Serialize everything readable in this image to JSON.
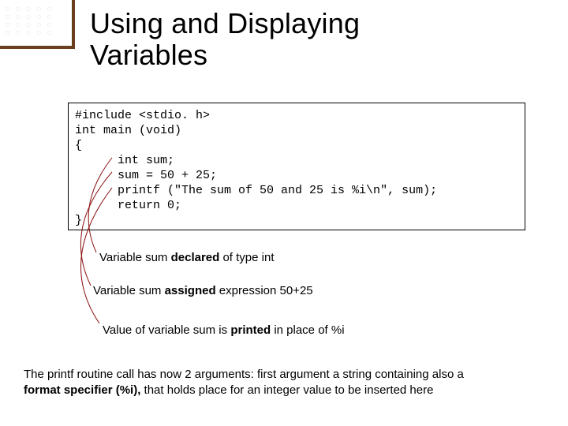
{
  "title_line1": "Using and Displaying",
  "title_line2": "Variables",
  "code": {
    "l1": "#include <stdio. h>",
    "l2": "int main (void)",
    "l3": "{",
    "l4": "      int sum;",
    "l5": "      sum = 50 + 25;",
    "l6": "      printf (\"The sum of 50 and 25 is %i\\n\", sum);",
    "l7": "      return 0;",
    "l8": "}"
  },
  "notes": {
    "n1_a": "Variable sum ",
    "n1_b": "declared",
    "n1_c": " of type int",
    "n2_a": "Variable sum ",
    "n2_b": "assigned",
    "n2_c": "  expression 50+25",
    "n3_a": "Value of variable sum is ",
    "n3_b": "printed",
    "n3_c": " in place of %i"
  },
  "footer": {
    "a": "The printf routine call has now 2 arguments: first argument a string containing also a ",
    "b": "format specifier (%i),",
    "c": " that holds place for an integer value to be inserted here"
  },
  "dots": "○○○○○\n○○○○○\n○○○○○\n○○○○○"
}
